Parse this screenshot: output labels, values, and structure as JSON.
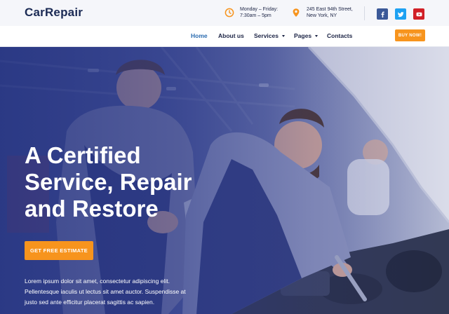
{
  "brand": {
    "logo_text": "CarRepair"
  },
  "topbar": {
    "hours": {
      "line1": "Monday – Friday:",
      "line2": "7:30am – 5pm",
      "icon": "clock-icon"
    },
    "address": {
      "line1": "245 East 94th Street,",
      "line2": "New York, NY",
      "icon": "map-pin-icon"
    },
    "social": [
      {
        "name": "facebook",
        "icon": "facebook-icon",
        "color": "#3b5998"
      },
      {
        "name": "twitter",
        "icon": "twitter-icon",
        "color": "#1da1f2"
      },
      {
        "name": "youtube",
        "icon": "youtube-icon",
        "color": "#d11f26"
      }
    ]
  },
  "nav": {
    "items": [
      {
        "label": "Home",
        "active": true
      },
      {
        "label": "About us"
      },
      {
        "label": "Services",
        "dropdown": true
      },
      {
        "label": "Pages",
        "dropdown": true
      },
      {
        "label": "Contacts"
      }
    ],
    "buy_label": "BUY NOW!"
  },
  "hero": {
    "title_lines": [
      "A Certified",
      "Service, Repair",
      "and Restore"
    ],
    "cta_label": "GET FREE ESTIMATE",
    "description_lines": [
      "Lorem ipsum dolor sit amet, consectetur adipiscing elit.",
      "Pellentesque iaculis ut lectus sit amet auctor. Suspendisse at",
      "justo sed ante efficitur placerat sagittis ac sapien."
    ]
  },
  "colors": {
    "accent": "#f7941d",
    "brand": "#1b2a54",
    "active_link": "#2b6cb0",
    "hero_overlay": "#263482"
  }
}
